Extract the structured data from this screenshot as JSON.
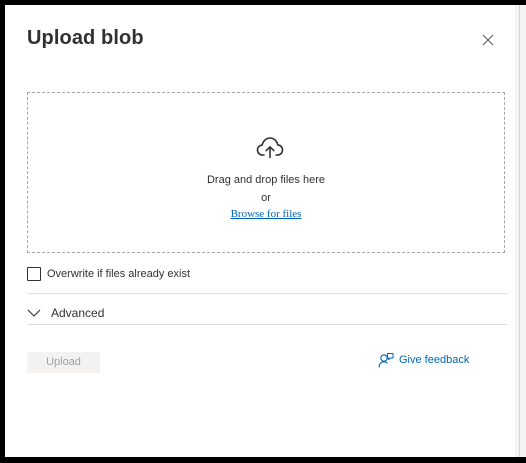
{
  "panel": {
    "title": "Upload blob",
    "close_icon": "close-icon"
  },
  "dropzone": {
    "icon": "cloud-upload-icon",
    "instruction": "Drag and drop files here",
    "or": "or",
    "browse_link": "Browse for files"
  },
  "overwrite": {
    "label": "Overwrite if files already exist",
    "checked": false
  },
  "advanced": {
    "label": "Advanced",
    "expanded": false,
    "icon": "chevron-down-icon"
  },
  "footer": {
    "upload_label": "Upload",
    "upload_disabled": true,
    "feedback_label": "Give feedback",
    "feedback_icon": "feedback-icon"
  },
  "colors": {
    "link": "#0067b8",
    "text": "#323130",
    "disabled_bg": "#f3f2f1",
    "disabled_text": "#a19f9d"
  }
}
